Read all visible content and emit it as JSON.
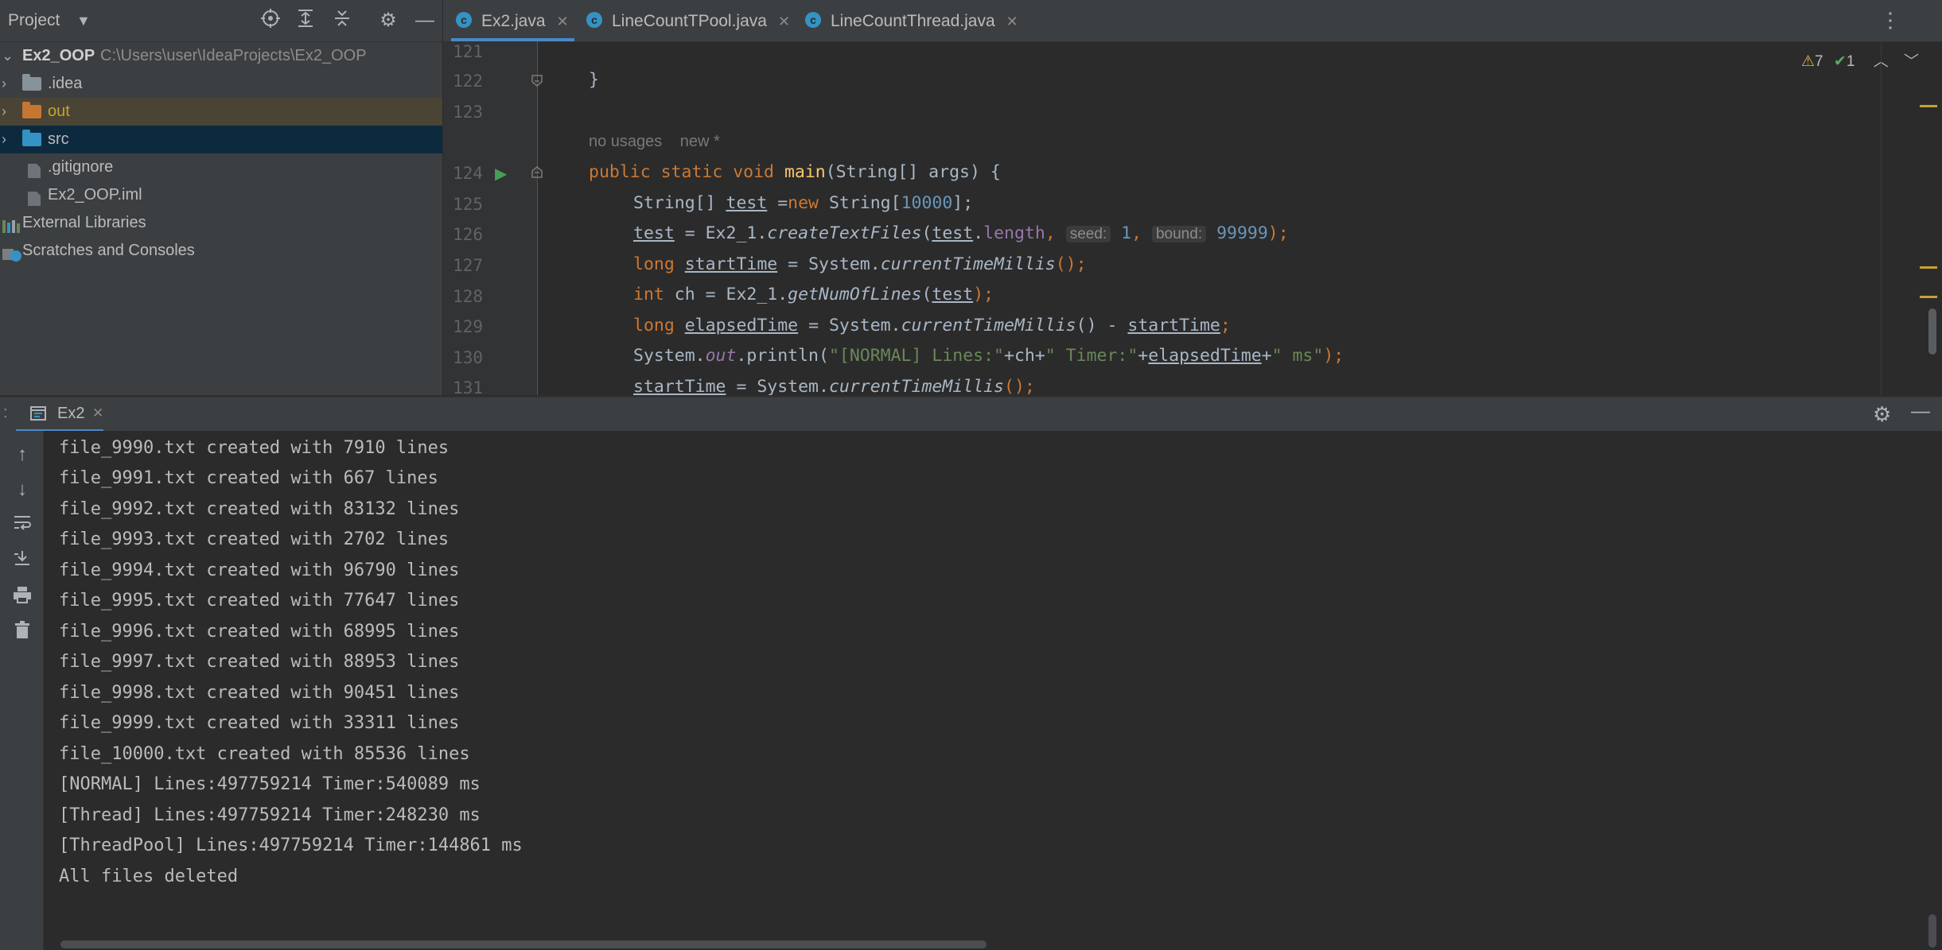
{
  "project": {
    "title": "Project",
    "root": {
      "name": "Ex2_OOP",
      "path": "C:\\Users\\user\\IdeaProjects\\Ex2_OOP"
    },
    "items": [
      {
        "label": ".idea"
      },
      {
        "label": "out"
      },
      {
        "label": "src"
      },
      {
        "label": ".gitignore"
      },
      {
        "label": "Ex2_OOP.iml"
      },
      {
        "label": "External Libraries"
      },
      {
        "label": "Scratches and Consoles"
      }
    ]
  },
  "editor": {
    "tabs": [
      {
        "label": "Ex2.java",
        "active": true
      },
      {
        "label": "LineCountTPool.java",
        "active": false
      },
      {
        "label": "LineCountThread.java",
        "active": false
      }
    ],
    "inspections": {
      "warnings": "7",
      "ok": "1"
    },
    "line_numbers": [
      "121",
      "122",
      "123",
      "124",
      "125",
      "126",
      "127",
      "128",
      "129",
      "130",
      "131"
    ],
    "annotation": {
      "usages": "no usages",
      "new": "new *"
    },
    "code": {
      "l122": "}",
      "l124_kw": "public static void ",
      "l124_fn": "main",
      "l124_rest": "(String[] args) {",
      "l125_a": "String[] ",
      "l125_var": "test",
      "l125_b": " =",
      "l125_kw": "new ",
      "l125_c": "String[",
      "l125_num": "10000",
      "l125_d": "];",
      "l126_var": "test",
      "l126_a": " = Ex2_1.",
      "l126_fn": "createTextFiles",
      "l126_b": "(",
      "l126_var2": "test",
      "l126_dot": ".",
      "l126_field": "length",
      "l126_comma": ", ",
      "l126_hint1": "seed:",
      "l126_num1": "1",
      "l126_comma2": ", ",
      "l126_hint2": "bound:",
      "l126_num2": "99999",
      "l126_end": ");",
      "l127_kw": "long ",
      "l127_var": "startTime",
      "l127_a": " = System.",
      "l127_fn": "currentTimeMillis",
      "l127_end": "();",
      "l128_kw": "int ",
      "l128_a": "ch = Ex2_1.",
      "l128_fn": "getNumOfLines",
      "l128_b": "(",
      "l128_var": "test",
      "l128_end": ");",
      "l129_kw": "long ",
      "l129_var": "elapsedTime",
      "l129_a": " = System.",
      "l129_fn": "currentTimeMillis",
      "l129_b": "() - ",
      "l129_var2": "startTime",
      "l129_end": ";",
      "l130_a": "System.",
      "l130_field": "out",
      "l130_b": ".println(",
      "l130_s1": "\"[NORMAL] Lines:\"",
      "l130_c": "+ch+",
      "l130_s2": "\" Timer:\"",
      "l130_d": "+",
      "l130_var": "elapsedTime",
      "l130_e": "+",
      "l130_s3": "\" ms\"",
      "l130_end": ");",
      "l131_var": "startTime",
      "l131_a": " = System.",
      "l131_fn": "currentTimeMillis",
      "l131_end": "();"
    }
  },
  "run": {
    "tab_label": "Ex2",
    "output": [
      "file_9990.txt created with 7910 lines",
      "file_9991.txt created with 667 lines",
      "file_9992.txt created with 83132 lines",
      "file_9993.txt created with 2702 lines",
      "file_9994.txt created with 96790 lines",
      "file_9995.txt created with 77647 lines",
      "file_9996.txt created with 68995 lines",
      "file_9997.txt created with 88953 lines",
      "file_9998.txt created with 90451 lines",
      "file_9999.txt created with 33311 lines",
      "file_10000.txt created with 85536 lines",
      "[NORMAL] Lines:497759214 Timer:540089 ms",
      "[Thread] Lines:497759214 Timer:248230 ms",
      "[ThreadPool] Lines:497759214 Timer:144861 ms",
      "All files deleted"
    ]
  },
  "colors": {
    "editor_bg": "#2b2b2b",
    "panel_bg": "#3c3f41",
    "keyword": "#cc7832",
    "function": "#ffc66d",
    "number": "#6897bb",
    "string": "#6a8759",
    "selection": "#0d293e",
    "out_folder": "#c57633"
  },
  "icons": [
    "chevron-down-icon",
    "locate-icon",
    "expand-all-icon",
    "collapse-all-icon",
    "gear-icon",
    "minimize-icon",
    "more-icon",
    "run-icon",
    "fold-icon",
    "arrow-up-icon",
    "arrow-down-icon",
    "soft-wrap-icon",
    "scroll-to-end-icon",
    "print-icon",
    "trash-icon"
  ]
}
